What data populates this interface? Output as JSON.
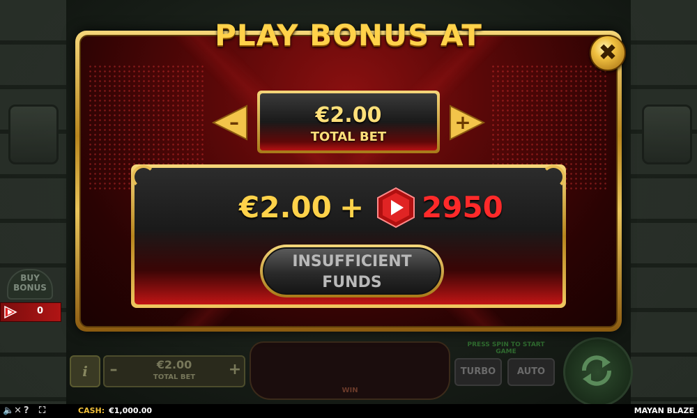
{
  "modal": {
    "title": "PLAY BONUS AT",
    "close_label": "✖",
    "decrease_label": "–",
    "increase_label": "+",
    "bet_amount": "€2.00",
    "bet_label": "TOTAL BET",
    "offer_price": "€2.00",
    "offer_plus": "+",
    "offer_spins": "2950",
    "button_line1": "INSUFFICIENT",
    "button_line2": "FUNDS"
  },
  "side": {
    "buy_bonus_line1": "BUY",
    "buy_bonus_line2": "BONUS",
    "bonus_count": "0"
  },
  "controls": {
    "info_label": "i",
    "bet_minus": "–",
    "bet_plus": "+",
    "bet_value": "€2.00",
    "bet_label": "TOTAL BET",
    "win_label": "WIN",
    "press_spin": "PRESS SPIN TO START GAME",
    "turbo_label": "TURBO",
    "auto_label": "AUTO"
  },
  "statusbar": {
    "mute_icon": "speaker-mute-icon",
    "help_icon": "?",
    "fullscreen_icon": "fullscreen-icon",
    "cash_label": "CASH:",
    "cash_value": "€1,000.00",
    "game_name": "MAYAN BLAZE"
  },
  "colors": {
    "gold": "#ffd24a",
    "red_accent": "#ff2a2a",
    "modal_red": "#5a0808"
  }
}
